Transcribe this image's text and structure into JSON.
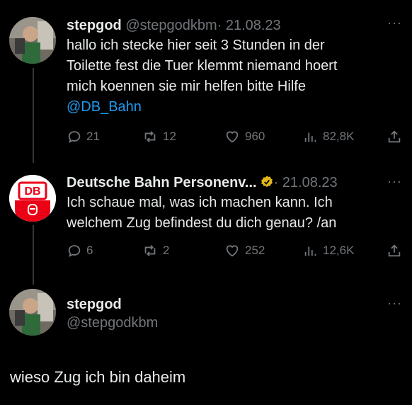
{
  "colors": {
    "background": "#000000",
    "text": "#e7e9ea",
    "muted": "#71767b",
    "link": "#1d9bf0",
    "db_red": "#ec0016",
    "verified_gold": "#e2b719"
  },
  "tweets": [
    {
      "name": "stepgod",
      "handle": "@stepgodkbm",
      "date": "· 21.08.23",
      "text_lines": [
        "hallo ich stecke hier seit 3 Stunden in der",
        "Toilette fest die Tuer klemmt niemand hoert",
        "mich koennen sie mir helfen bitte Hilfe"
      ],
      "mention": "@DB_Bahn",
      "replies": "21",
      "reposts": "12",
      "likes": "960",
      "views": "82,8K"
    },
    {
      "name": "Deutsche Bahn Personenv...",
      "date": "· 21.08.23",
      "avatar_logo": "DB",
      "text_lines": [
        "Ich schaue mal, was ich machen kann. Ich",
        "welchem Zug befindest du dich genau? /an"
      ],
      "replies": "6",
      "reposts": "2",
      "likes": "252",
      "views": "12,6K"
    },
    {
      "name": "stepgod",
      "handle": "@stepgodkbm",
      "text": "wieso Zug ich bin daheim"
    }
  ],
  "more_label": "···"
}
